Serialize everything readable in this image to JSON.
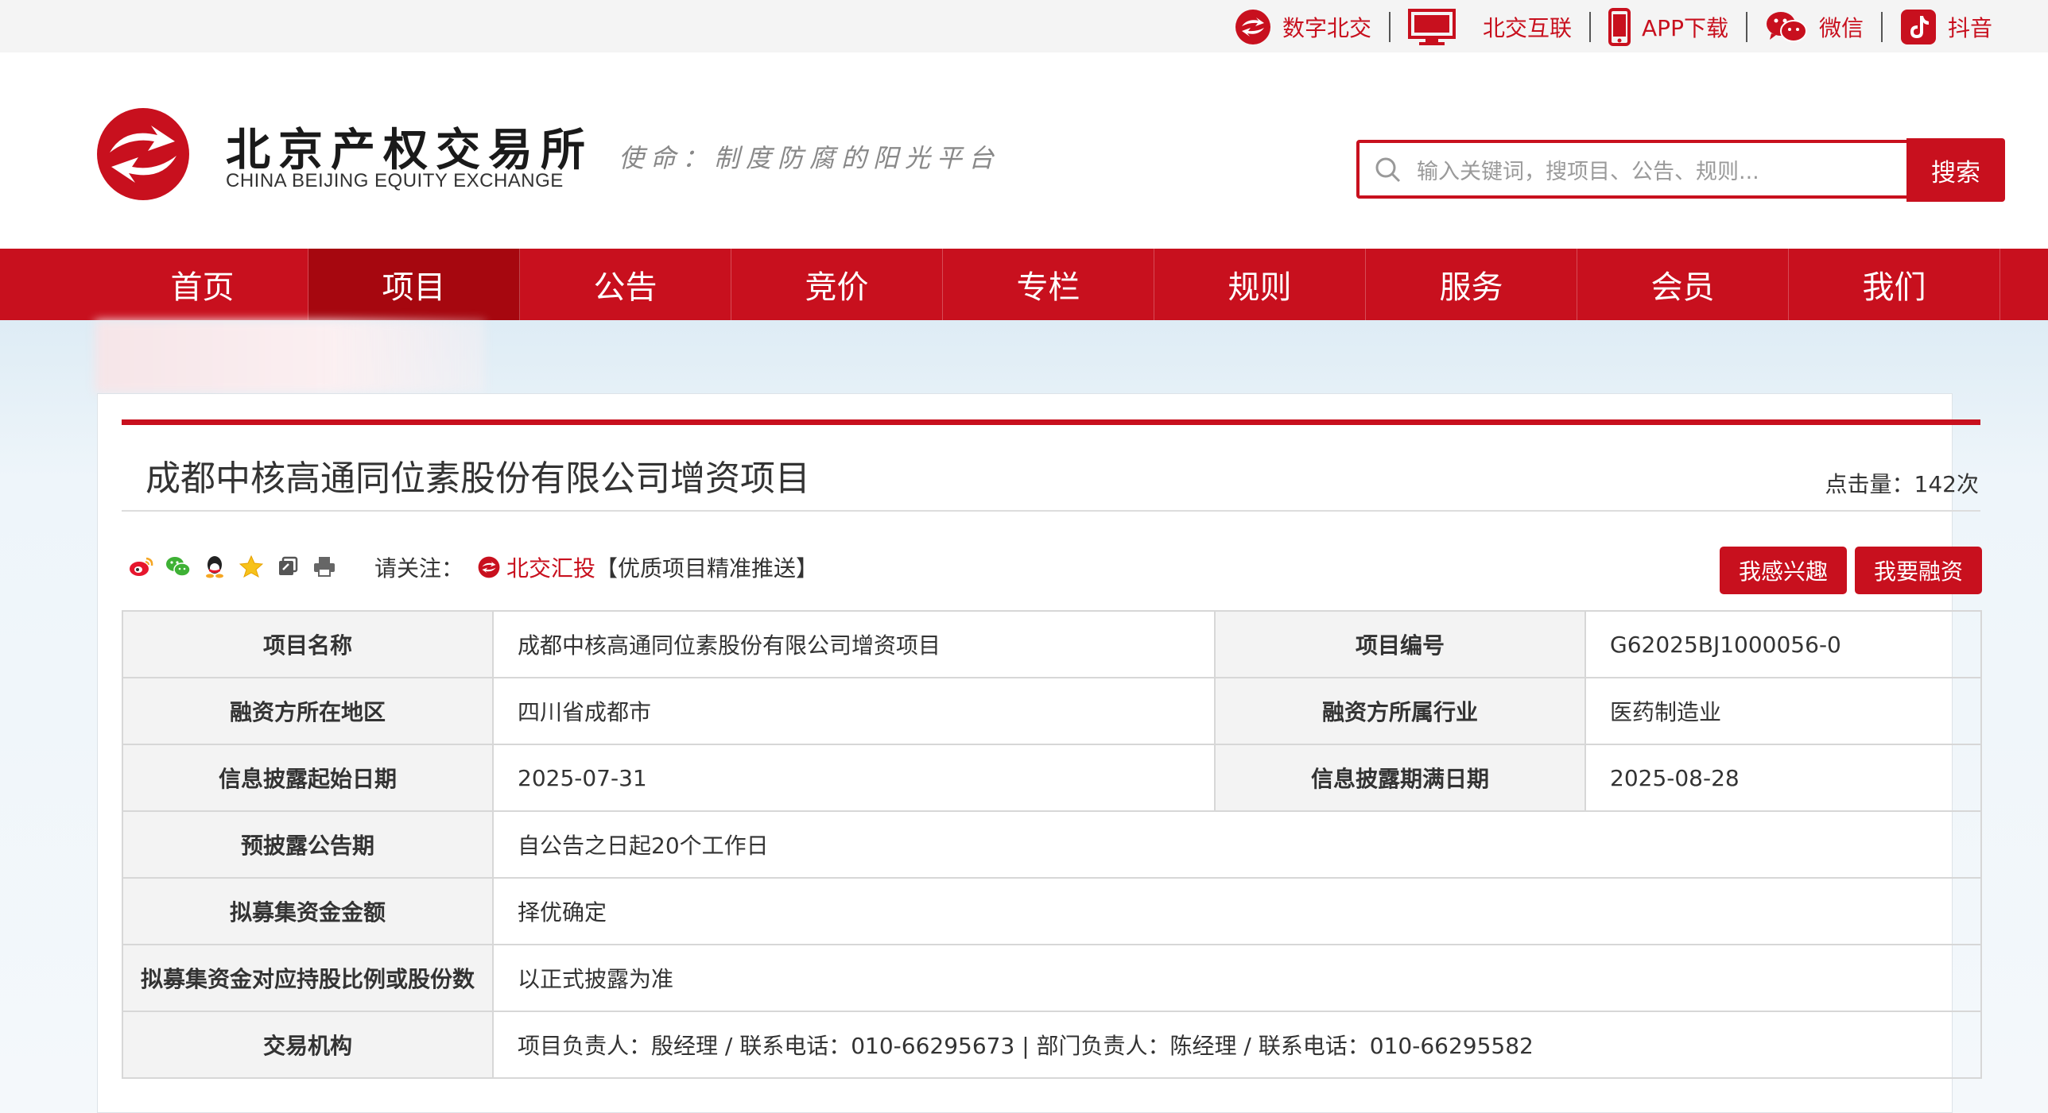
{
  "topbar": {
    "links": [
      {
        "label": "数字北交",
        "icon": "bjex-logo-icon"
      },
      {
        "label": "北交互联",
        "icon": "monitor-icon"
      },
      {
        "label": "APP下载",
        "icon": "phone-icon"
      },
      {
        "label": "微信",
        "icon": "wechat-icon"
      },
      {
        "label": "抖音",
        "icon": "douyin-icon"
      }
    ]
  },
  "header": {
    "logo_cn": "北京产权交易所",
    "logo_en": "CHINA BEIJING EQUITY EXCHANGE",
    "mission": "使命：制度防腐的阳光平台",
    "search_placeholder": "输入关键词，搜项目、公告、规则...",
    "search_button": "搜索"
  },
  "nav": {
    "items": [
      "首页",
      "项目",
      "公告",
      "竞价",
      "专栏",
      "规则",
      "服务",
      "会员",
      "我们"
    ],
    "active": "项目"
  },
  "project": {
    "title": "成都中核高通同位素股份有限公司增资项目",
    "clicks": "点击量：142次",
    "follow_label": "请关注：",
    "follow_brand": "北交汇投",
    "follow_suffix": "【优质项目精准推送】",
    "interest_button": "我感兴趣",
    "finance_button": "我要融资",
    "share_icons": [
      "weibo-icon",
      "wechat-share-icon",
      "qq-icon",
      "qzone-star-icon",
      "copy-link-icon",
      "print-icon"
    ]
  },
  "table": {
    "r1": {
      "l1": "项目名称",
      "v1": "成都中核高通同位素股份有限公司增资项目",
      "l2": "项目编号",
      "v2": "G62025BJ1000056-0"
    },
    "r2": {
      "l1": "融资方所在地区",
      "v1": "四川省成都市",
      "l2": "融资方所属行业",
      "v2": "医药制造业"
    },
    "r3": {
      "l1": "信息披露起始日期",
      "v1": "2025-07-31",
      "l2": "信息披露期满日期",
      "v2": "2025-08-28"
    },
    "r4": {
      "l1": "预披露公告期",
      "v1": "自公告之日起20个工作日"
    },
    "r5": {
      "l1": "拟募集资金金额",
      "v1": "择优确定"
    },
    "r6": {
      "l1": "拟募集资金对应持股比例或股份数",
      "v1": "以正式披露为准"
    },
    "r7": {
      "l1": "交易机构",
      "v1": "项目负责人：殷经理 / 联系电话：010-66295673 | 部门负责人：陈经理 / 联系电话：010-66295582"
    }
  },
  "colors": {
    "brand_red": "#c8101e",
    "nav_active": "#a6070f"
  }
}
